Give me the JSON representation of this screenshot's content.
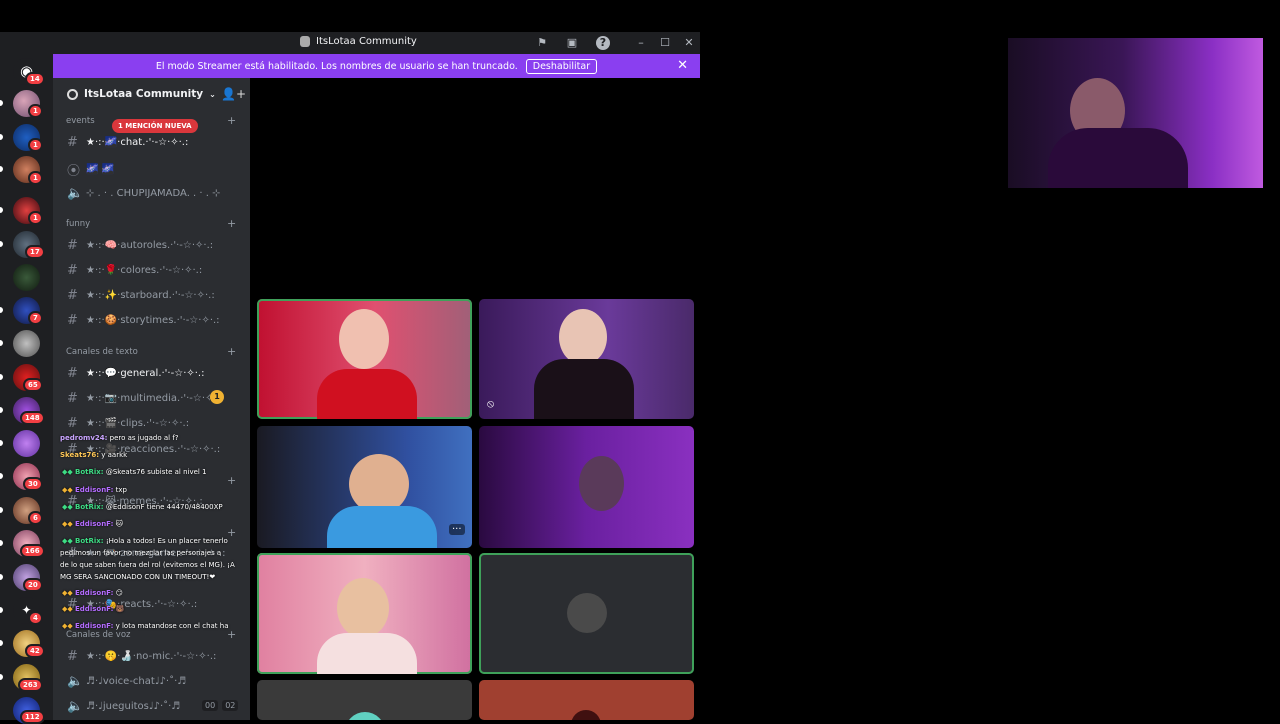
{
  "window": {
    "title": "ItsLotaa Community"
  },
  "banner": {
    "text": "El modo Streamer está habilitado. Los nombres de usuario se han truncado.",
    "button": "Deshabilitar"
  },
  "rail_badges": [
    "14",
    "1",
    "1",
    "1",
    "1",
    "17",
    "7",
    "65",
    "148",
    "30",
    "6",
    "166",
    "20",
    "4",
    "42",
    "263",
    "112"
  ],
  "guild": {
    "name": "ItsLotaa Community"
  },
  "mention_pill": "1 MENCIÓN NUEVA",
  "categories": {
    "events": "events",
    "funny": "funny",
    "text": "Canales de texto",
    "voice": "Canales de voz"
  },
  "channels": {
    "chat": "★·:·🌌·chat.·'·-☆·✧·.:",
    "stage": "🌌 🌌",
    "chupi": "⊹ . · . CHUPIJAMADA. . · . ⊹",
    "autoroles": "★·:·🧠·autoroles.·'·-☆·✧·.:",
    "colores": "★·:·🌹·colores.·'·-☆·✧·.:",
    "starboard": "★·:·✨·starboard.·'·-☆·✧·.:",
    "storytimes": "★·:·🍪·storytimes.·'·-☆·✧·.:",
    "general": "★·:·💬·general.·'·-☆·✧·.:",
    "multimedia": "★·:·📷·multimedia.·'·-☆·✧·.:",
    "clips": "★·:·🎬·clips.·'·-☆·✧·.:",
    "reacciones": "★·:·🎥·reacciones.·'·-☆·✧·.:",
    "memes": "★·:·😹·memes.·'·-☆·✧·.:",
    "zona": "★·:·🎮·zona-gamer.·'·-☆·✧·.:",
    "reacts": "★·:·🎭·reacts.·'·-☆·✧·.:",
    "nomic": "★·:·🤫·🍶·no-mic.·'·-☆·✧·.:",
    "voicechat": "♬·♩voice-chat♩♪·˚·♬",
    "jueguitos": "♬·♩jueguitos♩♪·˚·♬"
  },
  "multimedia_badge": "1",
  "voice_counts": [
    "00",
    "02"
  ],
  "chat_overlay": [
    {
      "user": "pedromv24:",
      "text": " pero as jugado al f?",
      "color": "#c9a4ff"
    },
    {
      "user": "Skeats76:",
      "text": " y aarkk",
      "color": "#ffc857"
    },
    {
      "user": "BotRix:",
      "text": " @Skeats76 subiste al nivel 1",
      "color": "#3ddc84"
    },
    {
      "user": "EddisonF:",
      "text": " txp",
      "color": "#b46cff"
    },
    {
      "user": "BotRix:",
      "text": " @EddisonF tiene 44470/48400XP",
      "color": "#3ddc84"
    },
    {
      "user": "EddisonF:",
      "text": " 🐱",
      "color": "#b46cff"
    },
    {
      "user": "BotRix:",
      "text": " ¡Hola a todos! Es un placer tenerlo",
      "color": "#3ddc84"
    },
    {
      "user": "",
      "text": "pedimos un favor no mezclar las personajes a",
      "color": "#fff"
    },
    {
      "user": "",
      "text": "de lo que saben fuera del rol (evitemos el MG). ¡A",
      "color": "#fff"
    },
    {
      "user": "",
      "text": "MG SERA SANCIONADO CON UN TIMEOUT!❤",
      "color": "#fff"
    },
    {
      "user": "EddisonF:",
      "text": " 😏",
      "color": "#b46cff"
    },
    {
      "user": "EddisonF:",
      "text": " 🐻",
      "color": "#b46cff"
    },
    {
      "user": "EddisonF:",
      "text": " y lota matandose con el chat ha",
      "color": "#b46cff"
    }
  ],
  "colors": {
    "accent": "#8a3ff0",
    "speaking": "#3fa15a",
    "mention": "#da373c"
  }
}
